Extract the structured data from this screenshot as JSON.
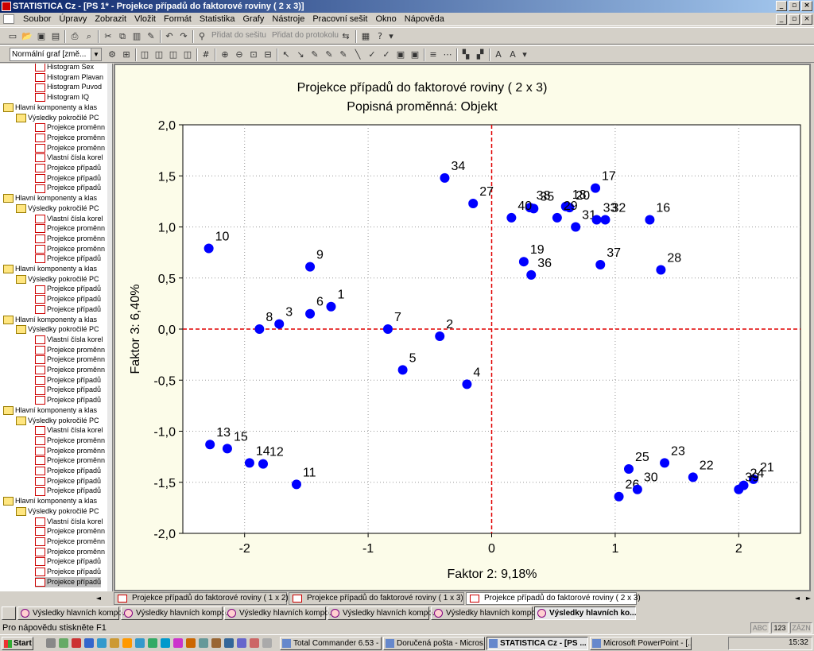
{
  "window": {
    "title": "STATISTICA Cz - [PS 1* - Projekce případů do faktorové roviny       ( 2 x  3)]",
    "controls": [
      "_",
      "▫",
      "×"
    ]
  },
  "menu": [
    "Soubor",
    "Úpravy",
    "Zobrazit",
    "Vložit",
    "Formát",
    "Statistika",
    "Grafy",
    "Nástroje",
    "Pracovní sešit",
    "Okno",
    "Nápověda"
  ],
  "toolbar1": {
    "add_workbook": "Přidat do sešitu",
    "add_protocol": "Přidat do protokolu"
  },
  "toolbar2": {
    "graph_type": "Normální graf [změ..."
  },
  "tree": [
    {
      "label": "Histogram Sex",
      "level": 3,
      "icon": "doc"
    },
    {
      "label": "Histogram Plavan",
      "level": 3,
      "icon": "doc"
    },
    {
      "label": "Histogram Puvod",
      "level": 3,
      "icon": "doc"
    },
    {
      "label": "Histogram IQ",
      "level": 3,
      "icon": "doc"
    },
    {
      "label": "Hlavní komponenty a klas",
      "level": 1,
      "icon": "fold"
    },
    {
      "label": "Výsledky pokročilé PC",
      "level": 2,
      "icon": "fold"
    },
    {
      "label": "Projekce proměnn",
      "level": 3,
      "icon": "doc"
    },
    {
      "label": "Projekce proměnn",
      "level": 3,
      "icon": "doc"
    },
    {
      "label": "Projekce proměnn",
      "level": 3,
      "icon": "doc"
    },
    {
      "label": "Vlastní čísla  korel",
      "level": 3,
      "icon": "doc"
    },
    {
      "label": "Projekce případů",
      "level": 3,
      "icon": "doc"
    },
    {
      "label": "Projekce případů",
      "level": 3,
      "icon": "doc"
    },
    {
      "label": "Projekce případů",
      "level": 3,
      "icon": "doc"
    },
    {
      "label": "Hlavní komponenty a klas",
      "level": 1,
      "icon": "fold"
    },
    {
      "label": "Výsledky pokročilé PC",
      "level": 2,
      "icon": "fold"
    },
    {
      "label": "Vlastní čísla  korel",
      "level": 3,
      "icon": "doc"
    },
    {
      "label": "Projekce proměnn",
      "level": 3,
      "icon": "doc"
    },
    {
      "label": "Projekce proměnn",
      "level": 3,
      "icon": "doc"
    },
    {
      "label": "Projekce proměnn",
      "level": 3,
      "icon": "doc"
    },
    {
      "label": "Projekce případů",
      "level": 3,
      "icon": "doc"
    },
    {
      "label": "Hlavní komponenty a klas",
      "level": 1,
      "icon": "fold"
    },
    {
      "label": "Výsledky pokročilé PC",
      "level": 2,
      "icon": "fold"
    },
    {
      "label": "Projekce případů",
      "level": 3,
      "icon": "doc"
    },
    {
      "label": "Projekce případů",
      "level": 3,
      "icon": "doc"
    },
    {
      "label": "Projekce případů",
      "level": 3,
      "icon": "doc"
    },
    {
      "label": "Hlavní komponenty a klas",
      "level": 1,
      "icon": "fold"
    },
    {
      "label": "Výsledky pokročilé PC",
      "level": 2,
      "icon": "fold"
    },
    {
      "label": "Vlastní čísla  korel",
      "level": 3,
      "icon": "doc"
    },
    {
      "label": "Projekce proměnn",
      "level": 3,
      "icon": "doc"
    },
    {
      "label": "Projekce proměnn",
      "level": 3,
      "icon": "doc"
    },
    {
      "label": "Projekce proměnn",
      "level": 3,
      "icon": "doc"
    },
    {
      "label": "Projekce případů",
      "level": 3,
      "icon": "doc"
    },
    {
      "label": "Projekce případů",
      "level": 3,
      "icon": "doc"
    },
    {
      "label": "Projekce případů",
      "level": 3,
      "icon": "doc"
    },
    {
      "label": "Hlavní komponenty a klas",
      "level": 1,
      "icon": "fold"
    },
    {
      "label": "Výsledky pokročilé PC",
      "level": 2,
      "icon": "fold"
    },
    {
      "label": "Vlastní čísla  korel",
      "level": 3,
      "icon": "doc"
    },
    {
      "label": "Projekce proměnn",
      "level": 3,
      "icon": "doc"
    },
    {
      "label": "Projekce proměnn",
      "level": 3,
      "icon": "doc"
    },
    {
      "label": "Projekce proměnn",
      "level": 3,
      "icon": "doc"
    },
    {
      "label": "Projekce případů",
      "level": 3,
      "icon": "doc"
    },
    {
      "label": "Projekce případů",
      "level": 3,
      "icon": "doc"
    },
    {
      "label": "Projekce případů",
      "level": 3,
      "icon": "doc"
    },
    {
      "label": "Hlavní komponenty a klas",
      "level": 1,
      "icon": "fold"
    },
    {
      "label": "Výsledky pokročilé PC",
      "level": 2,
      "icon": "fold"
    },
    {
      "label": "Vlastní čísla  korel",
      "level": 3,
      "icon": "doc"
    },
    {
      "label": "Projekce proměnn",
      "level": 3,
      "icon": "doc"
    },
    {
      "label": "Projekce proměnn",
      "level": 3,
      "icon": "doc"
    },
    {
      "label": "Projekce proměnn",
      "level": 3,
      "icon": "doc"
    },
    {
      "label": "Projekce případů",
      "level": 3,
      "icon": "doc"
    },
    {
      "label": "Projekce případů",
      "level": 3,
      "icon": "doc"
    },
    {
      "label": "Projekce případů",
      "level": 3,
      "icon": "doc",
      "selected": true
    }
  ],
  "chart_data": {
    "type": "scatter",
    "title": "Projekce případů do faktorové roviny        ( 2 x   3)",
    "subtitle": "Popisná proměnná:   Objekt",
    "xlabel": "Faktor 2:  9,18%",
    "ylabel": "Faktor 3:  6,40%",
    "xlim": [
      -2.5,
      2.5
    ],
    "ylim": [
      -2.0,
      2.0
    ],
    "xticks": [
      -2,
      -1,
      0,
      1,
      2
    ],
    "xtick_labels": [
      "-2",
      "-1",
      "0",
      "1",
      "2"
    ],
    "yticks": [
      2.0,
      1.5,
      1.0,
      0.5,
      0.0,
      -0.5,
      -1.0,
      -1.5,
      -2.0
    ],
    "ytick_labels": [
      "2,0",
      "1,5",
      "1,0",
      "0,5",
      "0,0",
      "-0,5",
      "-1,0",
      "-1,5",
      "-2,0"
    ],
    "point_color": "#0000ff",
    "zero_line_color": "#e00000",
    "grid": "dotted",
    "points": [
      {
        "label": "1",
        "x": -1.3,
        "y": 0.22
      },
      {
        "label": "2",
        "x": -0.42,
        "y": -0.07
      },
      {
        "label": "3",
        "x": -1.72,
        "y": 0.05
      },
      {
        "label": "4",
        "x": -0.2,
        "y": -0.54
      },
      {
        "label": "5",
        "x": -0.72,
        "y": -0.4
      },
      {
        "label": "6",
        "x": -1.47,
        "y": 0.15
      },
      {
        "label": "7",
        "x": -0.84,
        "y": 0.0
      },
      {
        "label": "8",
        "x": -1.88,
        "y": 0.0
      },
      {
        "label": "9",
        "x": -1.47,
        "y": 0.61
      },
      {
        "label": "10",
        "x": -2.29,
        "y": 0.79
      },
      {
        "label": "11",
        "x": -1.58,
        "y": -1.52
      },
      {
        "label": "12",
        "x": -1.85,
        "y": -1.32
      },
      {
        "label": "13",
        "x": -2.28,
        "y": -1.13
      },
      {
        "label": "14",
        "x": -1.96,
        "y": -1.31
      },
      {
        "label": "15",
        "x": -2.14,
        "y": -1.17
      },
      {
        "label": "16",
        "x": 1.28,
        "y": 1.07
      },
      {
        "label": "17",
        "x": 0.84,
        "y": 1.38
      },
      {
        "label": "18",
        "x": 0.6,
        "y": 1.2
      },
      {
        "label": "19",
        "x": 0.26,
        "y": 0.66
      },
      {
        "label": "20",
        "x": 0.63,
        "y": 1.19
      },
      {
        "label": "21",
        "x": 2.12,
        "y": -1.47
      },
      {
        "label": "22",
        "x": 1.63,
        "y": -1.45
      },
      {
        "label": "23",
        "x": 1.4,
        "y": -1.31
      },
      {
        "label": "24",
        "x": 2.04,
        "y": -1.53
      },
      {
        "label": "25",
        "x": 1.11,
        "y": -1.37
      },
      {
        "label": "26",
        "x": 1.03,
        "y": -1.64
      },
      {
        "label": "27",
        "x": -0.15,
        "y": 1.23
      },
      {
        "label": "28",
        "x": 1.37,
        "y": 0.58
      },
      {
        "label": "29",
        "x": 0.53,
        "y": 1.09
      },
      {
        "label": "30",
        "x": 1.18,
        "y": -1.57
      },
      {
        "label": "31",
        "x": 0.68,
        "y": 1.0
      },
      {
        "label": "32",
        "x": 0.92,
        "y": 1.07
      },
      {
        "label": "33",
        "x": 0.85,
        "y": 1.07
      },
      {
        "label": "34",
        "x": -0.38,
        "y": 1.48
      },
      {
        "label": "35",
        "x": 0.34,
        "y": 1.18
      },
      {
        "label": "36",
        "x": 0.32,
        "y": 0.53
      },
      {
        "label": "37",
        "x": 0.88,
        "y": 0.63
      },
      {
        "label": "38",
        "x": 0.31,
        "y": 1.19
      },
      {
        "label": "39",
        "x": 2.0,
        "y": -1.57
      },
      {
        "label": "40",
        "x": 0.16,
        "y": 1.09
      }
    ]
  },
  "graph_tabs": [
    {
      "label": "Projekce případů do faktorové roviny       ( 1 x  2)"
    },
    {
      "label": "Projekce případů do faktorové roviny       ( 1 x  3)"
    },
    {
      "label": "Projekce případů do faktorové roviny       ( 2 x  3)",
      "active": true
    }
  ],
  "window_buttons": [
    {
      "label": "Výsledky hlavních kompo..."
    },
    {
      "label": "Výsledky hlavních kompo..."
    },
    {
      "label": "Výsledky hlavních kompo..."
    },
    {
      "label": "Výsledky hlavních kompo..."
    },
    {
      "label": "Výsledky hlavních kompo..."
    },
    {
      "label": "Výsledky hlavních ko...",
      "active": true
    }
  ],
  "status": {
    "text": "Pro nápovědu stiskněte F1",
    "abc": "ABC",
    "num": "123",
    "zaznam": "ZÁZN"
  },
  "taskbar": {
    "start": "Start",
    "tasks": [
      {
        "label": "Total Commander 6.53 - ..."
      },
      {
        "label": "Doručená pošta - Micros..."
      },
      {
        "label": "STATISTICA Cz - [PS ...",
        "active": true
      },
      {
        "label": "Microsoft PowerPoint - [..."
      }
    ],
    "clock": "15:32"
  }
}
